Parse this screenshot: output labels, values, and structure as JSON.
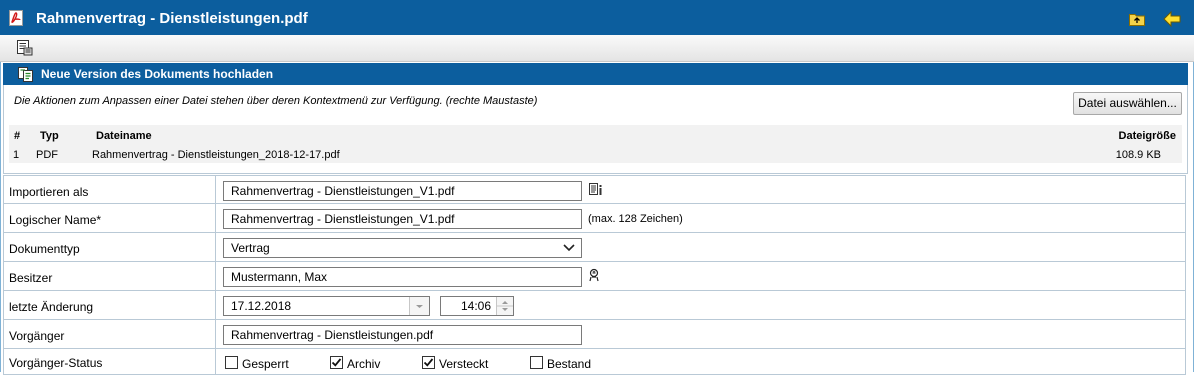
{
  "window": {
    "title": "Rahmenvertrag - Dienstleistungen.pdf"
  },
  "section": {
    "title": "Neue Version des Dokuments hochladen"
  },
  "info": {
    "hint": "Die Aktionen zum Anpassen einer Datei stehen über deren Kontextmenü zur Verfügung. (rechte Maustaste)",
    "select_button": "Datei auswählen..."
  },
  "file_table": {
    "headers": {
      "num": "#",
      "type": "Typ",
      "name": "Dateiname",
      "size": "Dateigröße"
    },
    "rows": [
      {
        "num": "1",
        "type": "PDF",
        "name": "Rahmenvertrag - Dienstleistungen_2018-12-17.pdf",
        "size": "108.9 KB"
      }
    ]
  },
  "form": {
    "import_as": {
      "label": "Importieren als",
      "value": "Rahmenvertrag - Dienstleistungen_V1.pdf"
    },
    "logical_name": {
      "label": "Logischer Name*",
      "value": "Rahmenvertrag - Dienstleistungen_V1.pdf",
      "note": "(max. 128 Zeichen)"
    },
    "doc_type": {
      "label": "Dokumenttyp",
      "value": "Vertrag"
    },
    "owner": {
      "label": "Besitzer",
      "value": "Mustermann, Max"
    },
    "last_change": {
      "label": "letzte Änderung",
      "date": "17.12.2018",
      "time": "14:06"
    },
    "predecessor": {
      "label": "Vorgänger",
      "value": "Rahmenvertrag - Dienstleistungen.pdf"
    },
    "predecessor_status": {
      "label": "Vorgänger-Status",
      "options": [
        {
          "label": "Gesperrt",
          "checked": false
        },
        {
          "label": "Archiv",
          "checked": true
        },
        {
          "label": "Versteckt",
          "checked": true
        },
        {
          "label": "Bestand",
          "checked": false
        }
      ]
    }
  },
  "colors": {
    "header_blue": "#0c5e9e",
    "border": "#b9c9d6",
    "table_bg": "#f2f2f2"
  },
  "icons": {
    "title": "pdf-icon",
    "folder_up": "folder-up-icon",
    "back": "back-arrow-icon",
    "toolbar": "document-properties-icon",
    "section": "upload-version-icon",
    "import_info": "file-info-icon",
    "owner": "user-icon"
  }
}
